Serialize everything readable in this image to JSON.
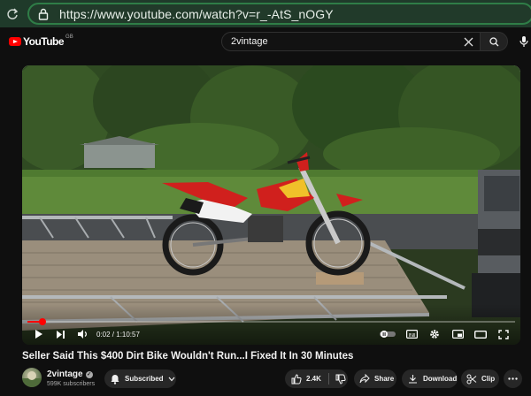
{
  "browser": {
    "url": "https://www.youtube.com/watch?v=r_-AtS_nOGY",
    "nav_icon": "refresh-icon",
    "lock_icon": "lock-icon"
  },
  "header": {
    "logo_text": "YouTube",
    "region": "GB",
    "search_value": "2vintage",
    "search_icon": "search-icon",
    "clear_icon": "close-icon",
    "mic_icon": "microphone-icon"
  },
  "player": {
    "time": "0:02 / 1:10:57",
    "progress": 0.03,
    "autoplay_on": true,
    "controls": [
      "play-icon",
      "next-icon",
      "volume-icon",
      "autoplay-toggle",
      "subtitles-icon",
      "settings-icon",
      "miniplayer-icon",
      "theater-icon",
      "fullscreen-icon"
    ]
  },
  "video": {
    "title": "Seller Said This $400 Dirt Bike Wouldn't Run...I Fixed It In 30 Minutes"
  },
  "channel": {
    "name": "2vintage",
    "subscribers": "599K subscribers"
  },
  "actions": {
    "subscribed_label": "Subscribed",
    "likes": "2.4K",
    "share_label": "Share",
    "download_label": "Download",
    "clip_label": "Clip"
  },
  "colors": {
    "accent": "#ff0000",
    "browser_bar": "#1f3a2a",
    "url_border": "#2f7d47",
    "background": "#0f0f0f"
  }
}
